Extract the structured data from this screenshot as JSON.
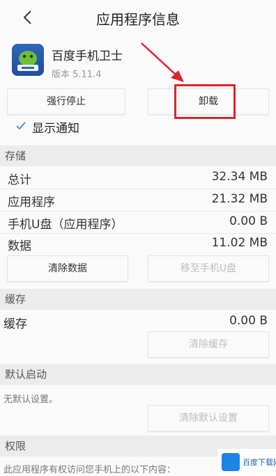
{
  "header": {
    "title": "应用程序信息"
  },
  "app": {
    "name": "百度手机卫士",
    "version": "版本 5.11.4"
  },
  "actions": {
    "force_stop": "强行停止",
    "uninstall": "卸载"
  },
  "notifications": {
    "label": "显示通知",
    "checked": true
  },
  "storage": {
    "section_title": "存储",
    "rows": [
      {
        "label": "总计",
        "value": "32.34 MB"
      },
      {
        "label": "应用程序",
        "value": "21.32 MB"
      },
      {
        "label": "手机U盘（应用程序）",
        "value": "0.00 B"
      },
      {
        "label": "数据",
        "value": "11.02 MB"
      }
    ],
    "clear_data": "清除数据",
    "move_to_usb": "移至手机U盘"
  },
  "cache": {
    "section_title": "缓存",
    "label": "缓存",
    "value": "0.00 B",
    "clear_cache": "清除缓存"
  },
  "default_launch": {
    "section_title": "默认启动",
    "note": "无默认设置。",
    "clear_defaults": "清除默认设置"
  },
  "permissions": {
    "section_title": "权限",
    "note": "此应用程序有权访问您手机上的以下内容："
  },
  "watermark": {
    "text": "百度下载网"
  },
  "colors": {
    "highlight": "#d9262b",
    "app_icon": "#2f67b8"
  }
}
